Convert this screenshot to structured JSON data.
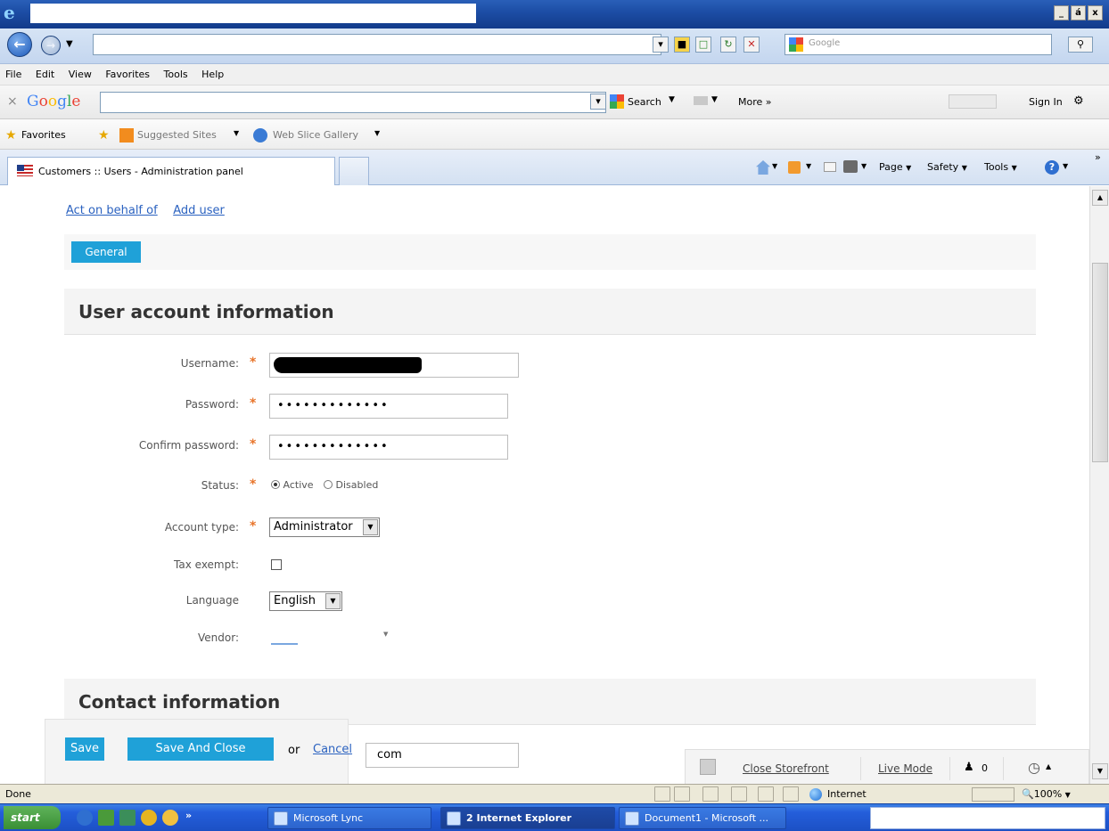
{
  "window": {
    "minimize": "_",
    "maximize": "á",
    "close": "x"
  },
  "address": {
    "value": "",
    "search_placeholder": "Google"
  },
  "menu": [
    "File",
    "Edit",
    "View",
    "Favorites",
    "Tools",
    "Help"
  ],
  "google_toolbar": {
    "close": "×",
    "logo": "Google",
    "search_label": "Search",
    "more_label": "More »",
    "sign_in": "Sign In"
  },
  "favorites_bar": {
    "favorites": "Favorites",
    "suggested_sites": "Suggested Sites",
    "web_slice": "Web Slice Gallery"
  },
  "tabs": {
    "active_title": "Customers :: Users - Administration panel"
  },
  "commands": {
    "page": "Page",
    "safety": "Safety",
    "tools": "Tools"
  },
  "page": {
    "top_links": [
      "Act on behalf of",
      "Add user"
    ],
    "tab_general": "General",
    "section_account": "User account information",
    "section_contact": "Contact information",
    "fields": {
      "username_label": "Username:",
      "password_label": "Password:",
      "password_value": "•••••••••••••",
      "confirm_label": "Confirm password:",
      "confirm_value": "•••••••••••••",
      "status_label": "Status:",
      "status_active": "Active",
      "status_disabled": "Disabled",
      "account_type_label": "Account type:",
      "account_type_value": "Administrator",
      "tax_exempt_label": "Tax exempt:",
      "language_label": "Language",
      "language_value": "English",
      "vendor_label": "Vendor:",
      "email_partial": "com"
    },
    "required_mark": "*",
    "save": "Save",
    "save_and_close": "Save And Close",
    "or": "or",
    "cancel": "Cancel",
    "close_storefront": "Close Storefront",
    "live_mode": "Live Mode",
    "users_count": "0"
  },
  "status": {
    "done": "Done",
    "zone": "Internet",
    "zoom": "100%"
  },
  "taskbar": {
    "start": "start",
    "more": "»",
    "lync": "Microsoft Lync",
    "ie": "2 Internet Explorer",
    "doc": "Document1 - Microsoft ..."
  }
}
